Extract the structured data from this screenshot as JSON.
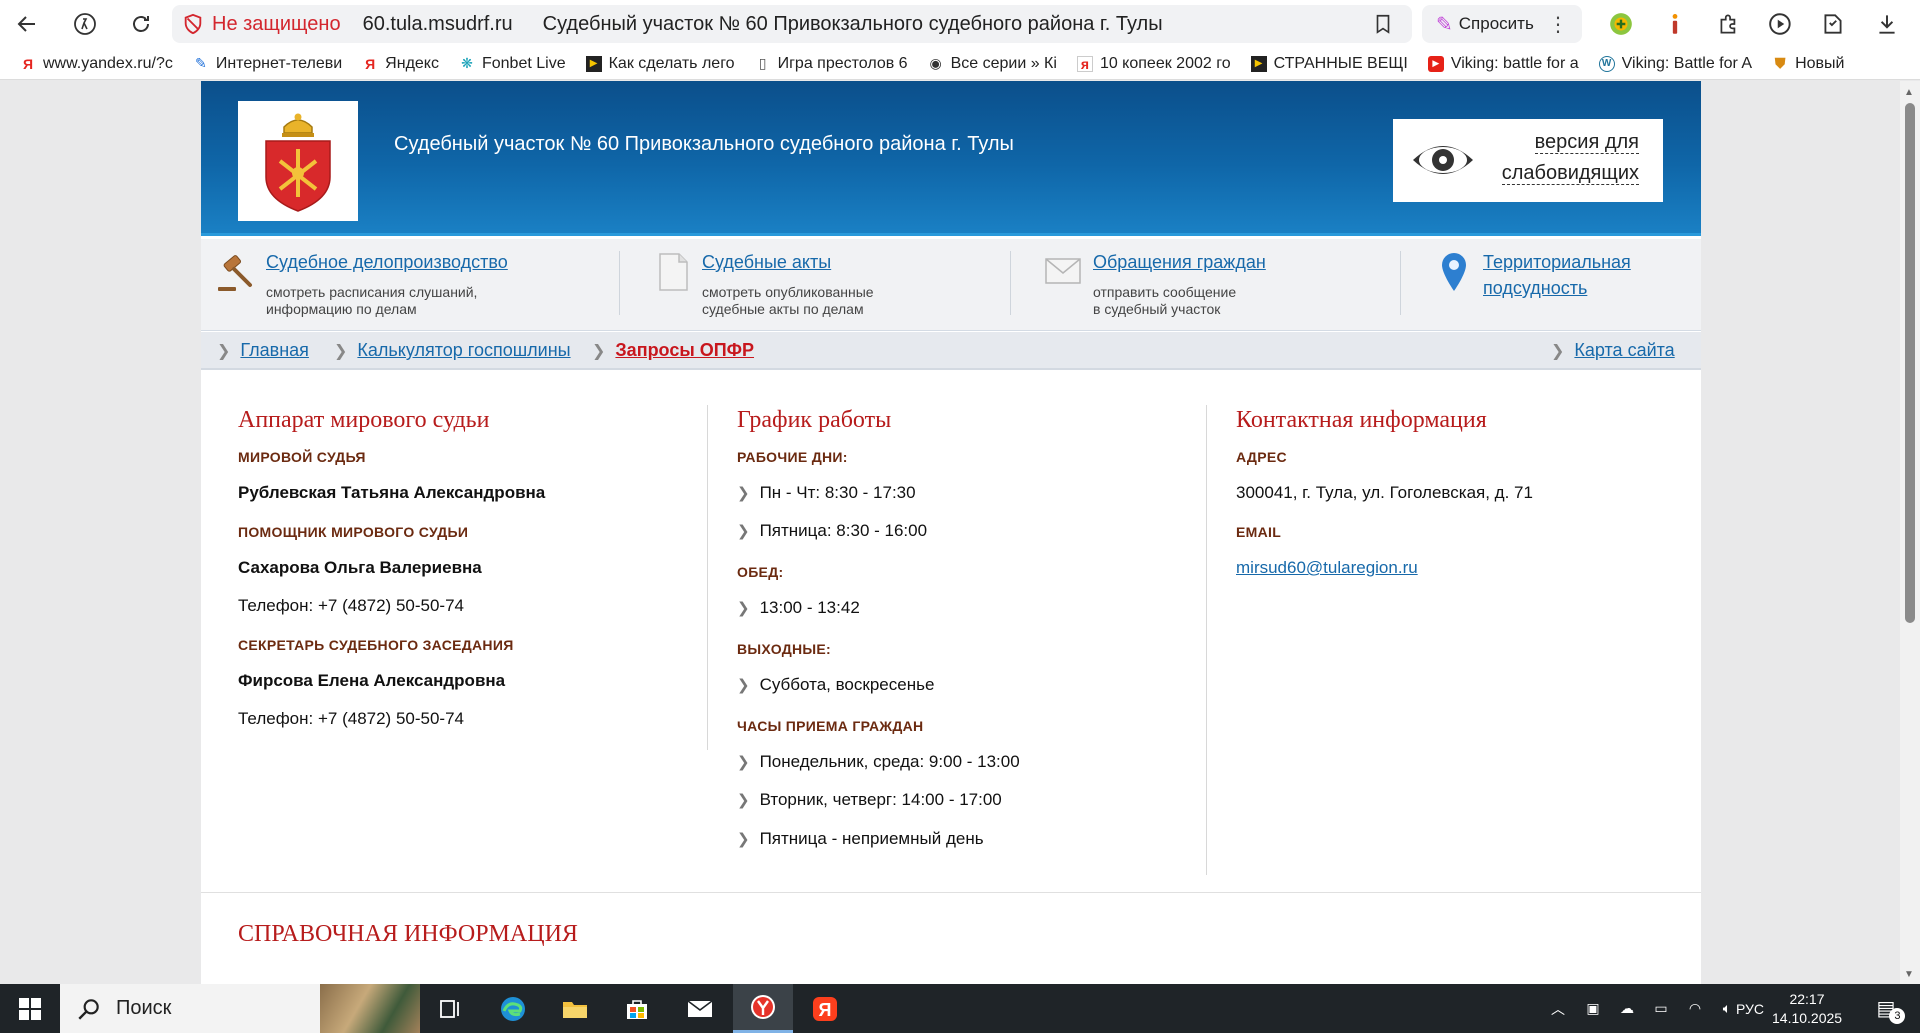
{
  "browser": {
    "security_label": "Не защищено",
    "url": "60.tula.msudrf.ru",
    "page_title": "Судебный участок № 60 Привокзального судебного района г. Тулы",
    "ask_label": "Спросить",
    "bookmarks": [
      {
        "icon": "yandex-icon",
        "label": "www.yandex.ru/?c"
      },
      {
        "icon": "tv-icon",
        "label": "Интернет-телеви"
      },
      {
        "icon": "yandex-icon",
        "label": "Яндекс"
      },
      {
        "icon": "fonbet-icon",
        "label": "Fonbet Live"
      },
      {
        "icon": "play-icon",
        "label": "Как сделать лего"
      },
      {
        "icon": "doc-icon",
        "label": "Игра престолов 6"
      },
      {
        "icon": "film-icon",
        "label": "Все серии » Кі"
      },
      {
        "icon": "yandex-icon",
        "label": "10 копеек 2002 го"
      },
      {
        "icon": "play-icon",
        "label": "СТРАННЫЕ ВЕЩІ"
      },
      {
        "icon": "youtube-icon",
        "label": "Viking: battle for a"
      },
      {
        "icon": "wordpress-icon",
        "label": "Viking: Battle for A"
      },
      {
        "icon": "shield-icon",
        "label": "Новый"
      }
    ]
  },
  "site": {
    "title": "Судебный участок № 60 Привокзального судебного района г. Тулы",
    "vision_line1": "версия для",
    "vision_line2": "слабовидящих"
  },
  "quick": [
    {
      "icon": "gavel-icon",
      "title": "Судебное делопроизводство",
      "desc1": "смотреть расписания слушаний,",
      "desc2": "информацию по делам"
    },
    {
      "icon": "document-icon",
      "title": "Судебные акты",
      "desc1": "смотреть опубликованные",
      "desc2": "судебные акты по делам"
    },
    {
      "icon": "envelope-icon",
      "title": "Обращения граждан",
      "desc1": "отправить сообщение",
      "desc2": "в судебный участок"
    },
    {
      "icon": "map-pin-icon",
      "title": "Территориальная",
      "title2": "подсудность"
    }
  ],
  "breadcrumbs": {
    "items": [
      "Главная",
      "Калькулятор госпошлины",
      "Запросы ОПФР"
    ],
    "sitemap": "Карта сайта"
  },
  "apparatus": {
    "heading": "Аппарат мирового судьи",
    "judge_label": "МИРОВОЙ СУДЬЯ",
    "judge_name": "Рублевская Татьяна Александровна",
    "assistant_label": "ПОМОЩНИК МИРОВОГО СУДЬИ",
    "assistant_name": "Сахарова Ольга Валериевна",
    "assistant_phone": "Телефон:  +7 (4872) 50-50-74",
    "secretary_label": "СЕКРЕТАРЬ СУДЕБНОГО ЗАСЕДАНИЯ",
    "secretary_name": "Фирсова Елена Александровна",
    "secretary_phone": "Телефон:  +7 (4872) 50-50-74"
  },
  "schedule": {
    "heading": "График работы",
    "workdays_label": "РАБОЧИЕ ДНИ:",
    "workdays": [
      "Пн - Чт: 8:30 - 17:30",
      "Пятница: 8:30 - 16:00"
    ],
    "lunch_label": "ОБЕД:",
    "lunch": [
      "13:00 - 13:42"
    ],
    "weekend_label": "ВЫХОДНЫЕ:",
    "weekend": [
      "Суббота, воскресенье"
    ],
    "reception_label": "ЧАСЫ ПРИЕМА ГРАЖДАН",
    "reception": [
      "Понедельник, среда: 9:00 - 13:00",
      "Вторник, четверг: 14:00 - 17:00",
      "Пятница - неприемный день"
    ]
  },
  "contacts": {
    "heading": "Контактная информация",
    "address_label": "АДРЕС",
    "address": "300041, г. Тула, ул. Гоголевская, д. 71",
    "email_label": "EMAIL",
    "email": "mirsud60@tularegion.ru"
  },
  "reference_heading": "СПРАВОЧНАЯ ИНФОРМАЦИЯ",
  "taskbar": {
    "search_placeholder": "Поиск",
    "lang": "РУС",
    "time": "22:17",
    "date": "14.10.2025",
    "notifications": "3"
  },
  "colors": {
    "header_blue": "#0f66a8",
    "link_blue": "#1769aa",
    "heading_red": "#b71c1c",
    "label_brown": "#6b2a10"
  }
}
